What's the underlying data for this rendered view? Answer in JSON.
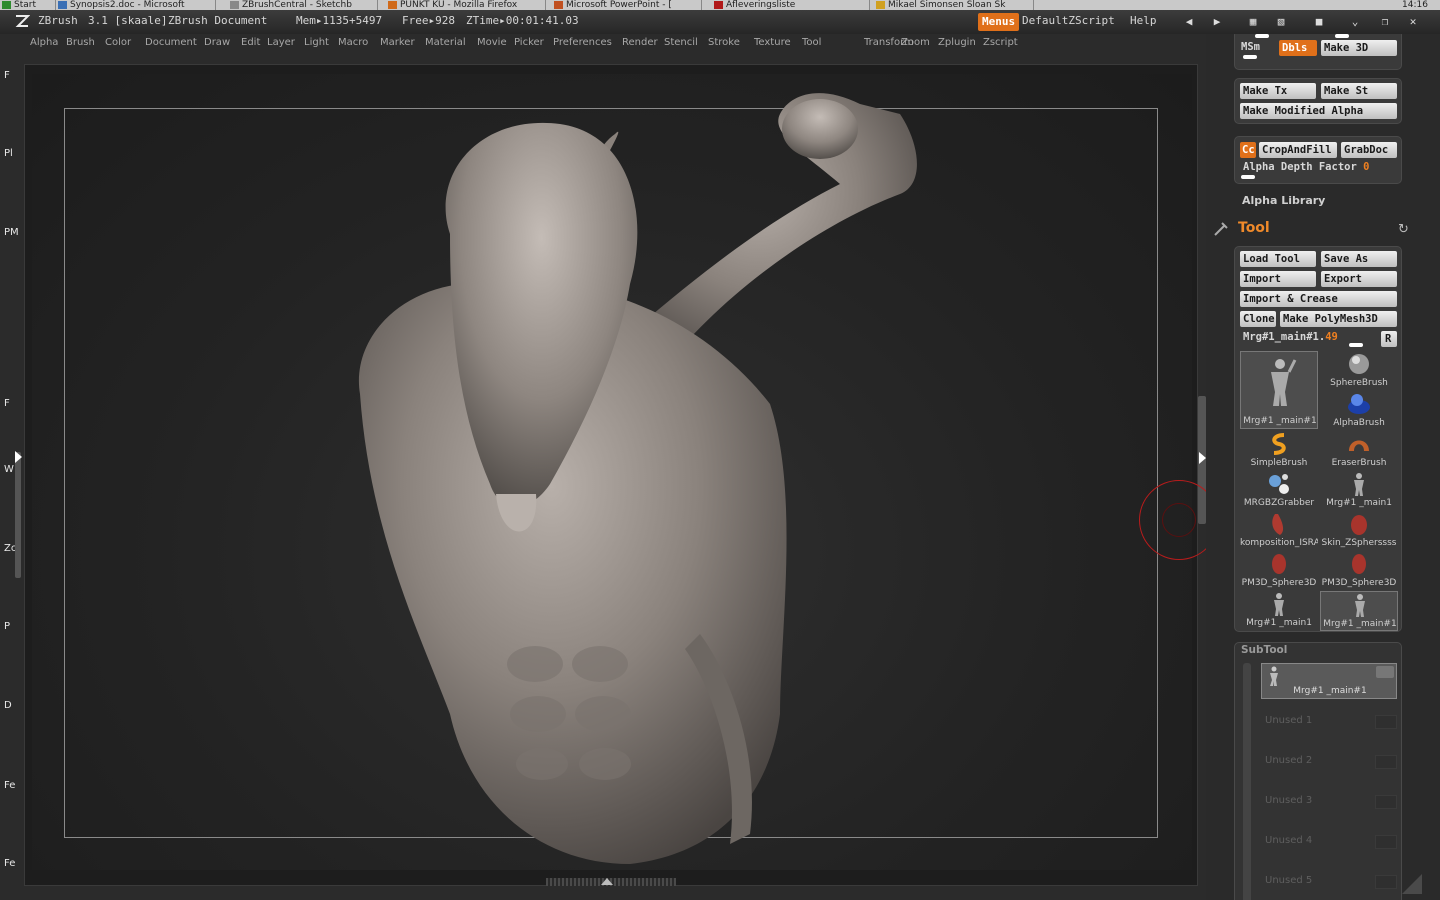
{
  "taskbar": {
    "items": [
      "Start",
      "Synopsis2.doc - Microsoft",
      "ZBrushCentral - Sketchb",
      "PUNKT KU - Mozilla Firefox",
      "Microsoft PowerPoint - [",
      "Afleveringsliste",
      "Mikael Simonsen Sloan Sk"
    ],
    "clock": "14:16"
  },
  "titlebar": {
    "app": "ZBrush",
    "version": "3.1 [skaale]",
    "document": "ZBrush Document",
    "mem": "Mem▸1135+5497",
    "free": "Free▸928",
    "ztime": "ZTime▸00:01:41.03",
    "menus_button": "Menus",
    "script": "DefaultZScript",
    "help": "Help"
  },
  "menubar": {
    "items": [
      "Alpha",
      "Brush",
      "Color",
      "Document",
      "Draw",
      "Edit",
      "Layer",
      "Light",
      "Macro",
      "Marker",
      "Material",
      "Movie",
      "Picker",
      "Preferences",
      "Render",
      "Stencil",
      "Stroke",
      "Texture",
      "Tool",
      "Transform",
      "Zoom",
      "Zplugin",
      "Zscript"
    ]
  },
  "left_shelf": {
    "letters": [
      "F",
      "Pl",
      "PM",
      "F",
      "W",
      "Zc",
      "P",
      "D",
      "Fe",
      "Fe"
    ]
  },
  "alpha_palette": {
    "msm": "MSm",
    "dbls": "Dbls",
    "make3d": "Make 3D",
    "make_tx": "Make Tx",
    "make_st": "Make St",
    "make_modified_alpha": "Make Modified Alpha",
    "cc": "Cc",
    "crop_and_fill": "CropAndFill",
    "grab_doc": "GrabDoc",
    "alpha_depth_factor_label": "Alpha Depth Factor",
    "alpha_depth_factor_value": "0",
    "alpha_library": "Alpha Library"
  },
  "tool_palette": {
    "title": "Tool",
    "load_tool": "Load Tool",
    "save_as": "Save As",
    "import": "Import",
    "export": "Export",
    "import_crease": "Import & Crease",
    "clone": "Clone",
    "make_polymesh": "Make PolyMesh3D",
    "current_tool_label": "Mrg#1_main#1.",
    "current_tool_value": "49",
    "r_button": "R",
    "tools": [
      {
        "label": "Mrg#1 _main#1",
        "icon": "figure-icon",
        "selected": true
      },
      {
        "label": "SphereBrush",
        "icon": "sphere-icon",
        "selected": false
      },
      {
        "label": "AlphaBrush",
        "icon": "alpha-brush-icon",
        "selected": false
      },
      {
        "label": "SimpleBrush",
        "icon": "simple-brush-icon",
        "selected": false
      },
      {
        "label": "EraserBrush",
        "icon": "eraser-brush-icon",
        "selected": false
      },
      {
        "label": "MRGBZGrabber",
        "icon": "grabber-icon",
        "selected": false
      },
      {
        "label": "Mrg#1 _main1",
        "icon": "figure-icon",
        "selected": false
      },
      {
        "label": "komposition_ISRA",
        "icon": "red-mesh-icon",
        "selected": false
      },
      {
        "label": "Skin_ZSpherssss",
        "icon": "red-mesh-icon",
        "selected": false
      },
      {
        "label": "PM3D_Sphere3D",
        "icon": "red-mesh-icon",
        "selected": false
      },
      {
        "label": "PM3D_Sphere3D",
        "icon": "red-mesh-icon",
        "selected": false
      },
      {
        "label": "Mrg#1 _main1",
        "icon": "figure-icon",
        "selected": false
      },
      {
        "label": "Mrg#1 _main#1",
        "icon": "figure-icon",
        "selected": true
      }
    ]
  },
  "subtool": {
    "title": "SubTool",
    "active": "Mrg#1 _main#1",
    "unused": [
      "Unused 1",
      "Unused 2",
      "Unused 3",
      "Unused 4",
      "Unused 5"
    ]
  },
  "colors": {
    "accent": "#e0701a",
    "panel": "#3a3a3a",
    "background": "#2b2b2b"
  }
}
